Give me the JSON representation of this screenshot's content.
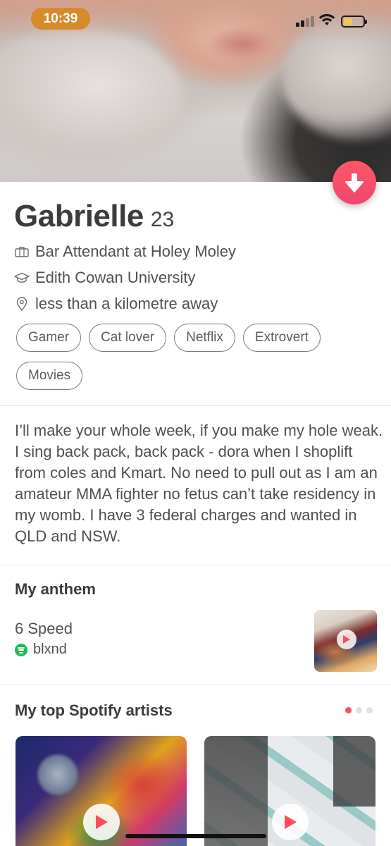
{
  "status_bar": {
    "time": "10:39",
    "signal_bars": 2,
    "battery_level": 0.45
  },
  "profile": {
    "name": "Gabrielle",
    "age": "23",
    "job": "Bar Attendant at Holey Moley",
    "school": "Edith Cowan University",
    "distance": "less than a kilometre away",
    "interests": [
      "Gamer",
      "Cat lover",
      "Netflix",
      "Extrovert",
      "Movies"
    ],
    "bio": "I’ll make your whole week, if you make my hole weak. I sing back pack, back pack - dora when I shoplift from coles and Kmart. No need to pull out as I am an amateur MMA fighter no fetus can’t take residency in my womb. I have 3 federal charges and wanted in QLD and NSW."
  },
  "anthem": {
    "section_title": "My anthem",
    "song": "6 Speed",
    "artist": "blxnd"
  },
  "top_artists": {
    "section_title": "My top Spotify artists",
    "page_count": 3,
    "active_page": 1
  },
  "icons": {
    "down_button": "arrow-down-icon",
    "job": "briefcase-icon",
    "school": "graduation-cap-icon",
    "distance": "location-pin-icon",
    "spotify": "spotify-icon",
    "play": "play-icon"
  },
  "colors": {
    "accent": "#ff4b5c",
    "status_time_pill": "#d68a2a",
    "spotify_green": "#1db954"
  }
}
